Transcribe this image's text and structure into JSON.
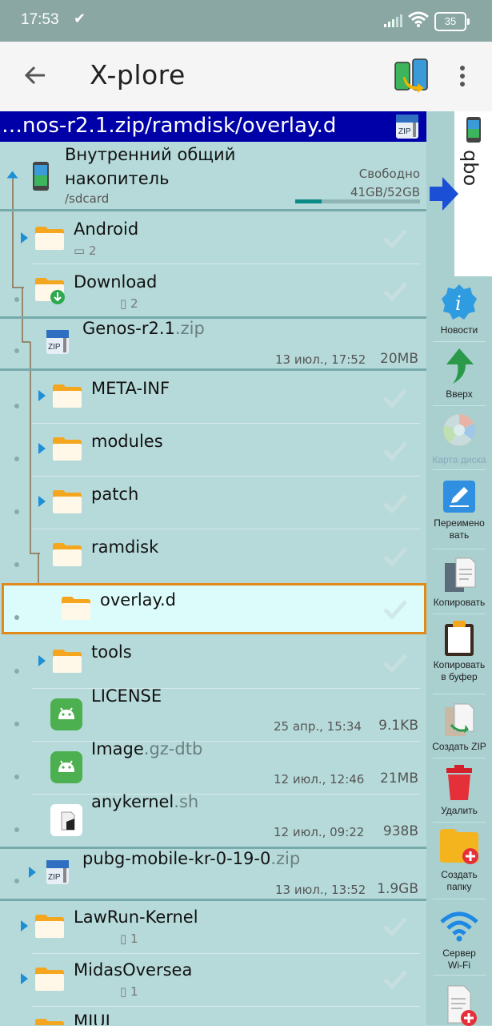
{
  "status": {
    "time": "17:53",
    "battery": "35"
  },
  "app": {
    "title": "X-plore"
  },
  "path": {
    "text": "…nos-r2.1.zip/ramdisk/overlay.d"
  },
  "storage": {
    "name_line1": "Внутренний общий",
    "name_line2": "накопитель",
    "path": "/sdcard",
    "free_label": "Свободно",
    "free_value": "41GB/52GB",
    "used_fraction": 0.21
  },
  "tree": [
    {
      "name": "Android",
      "count": "2"
    },
    {
      "name": "Download",
      "count": "2"
    },
    {
      "name": "Genos-r2.1",
      "ext": ".zip",
      "date": "13 июл., 17:52",
      "size": "20MB"
    },
    {
      "name": "META-INF"
    },
    {
      "name": "modules"
    },
    {
      "name": "patch"
    },
    {
      "name": "ramdisk"
    },
    {
      "name": "overlay.d"
    },
    {
      "name": "tools"
    },
    {
      "name": "LICENSE",
      "date": "25 апр., 15:34",
      "size": "9.1KB"
    },
    {
      "name": "Image",
      "ext": ".gz-dtb",
      "date": "12 июл., 12:46",
      "size": "21MB"
    },
    {
      "name": "anykernel",
      "ext": ".sh",
      "date": "12 июл., 09:22",
      "size": "938B"
    },
    {
      "name": "pubg-mobile-kr-0-19-0",
      "ext": ".zip",
      "date": "13 июл., 13:52",
      "size": "1.9GB"
    },
    {
      "name": "LawRun-Kernel",
      "count": "1"
    },
    {
      "name": "MidasOversea",
      "count": "1"
    },
    {
      "name": "MIUI"
    }
  ],
  "side_panel": {
    "right_pane_label": "qbo",
    "tools": [
      {
        "label": "Новости"
      },
      {
        "label": "Вверх"
      },
      {
        "label": "Карта диска"
      },
      {
        "label": "Переимено вать"
      },
      {
        "label": "Копировать"
      },
      {
        "label": "Копировать в буфер"
      },
      {
        "label": "Создать ZIP"
      },
      {
        "label": "Удалить"
      },
      {
        "label": "Создать папку"
      },
      {
        "label": "Сервер Wi-Fi"
      }
    ]
  },
  "colors": {
    "accent": "#0000a8",
    "selection": "#e08a1a",
    "panel": "#b6dada"
  }
}
